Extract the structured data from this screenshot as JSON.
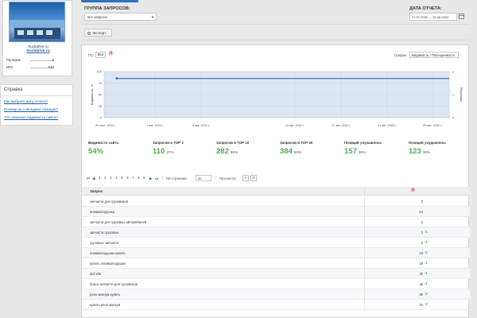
{
  "sidebar": {
    "site_domain": "truckdrive.ru",
    "site_link": "truckdrive.ru",
    "metrics": [
      {
        "label": "РејтБанк",
        "value": "0"
      },
      {
        "label": "ИКС",
        "value": "540"
      }
    ],
    "help": {
      "title": "Справка",
      "links": [
        "Как выбрать дату отчета?",
        "Почему не совпадают позиции?",
        "Что означает видимость сайта?"
      ]
    }
  },
  "filters": {
    "group_label": "ГРУППА ЗАПРОСОВ:",
    "group_value": "все запросы",
    "date_label": "ДАТА ОТЧЕТА:",
    "date_value": "27.07.2022 — 26.08.2022",
    "export_label": "Экспорт"
  },
  "chart_controls": {
    "ps_label": "ПС:",
    "ps_all": "Все",
    "ya_logo": "Я",
    "graph_label": "График:",
    "graph_value": "Видимость / Посещаемость"
  },
  "chart_data": {
    "type": "line",
    "xlabel": "",
    "ylabel": "Видимость, %",
    "y2label": "Переходы",
    "x_ticks": [
      "26 июл. 2022 г.",
      "1 авг. 2022 г.",
      "5 авг. 2022 г.",
      "13 авг. 2022 г.",
      "17 авг. 2022 г.",
      "21 авг. 2022 г.",
      "25 авг. 2022 г."
    ],
    "y_ticks": [
      0,
      25,
      50,
      75,
      100
    ],
    "y2_ticks": [
      0,
      1,
      2
    ],
    "ylim": [
      0,
      100
    ],
    "y2lim": [
      0,
      2
    ],
    "series": [
      {
        "values": [
          85,
          85,
          85,
          85,
          85,
          85,
          85,
          85,
          85,
          85,
          85,
          85,
          85,
          85,
          85,
          85,
          85,
          85,
          85,
          85,
          85,
          85,
          85,
          85,
          85,
          85,
          85,
          85,
          85,
          85,
          85
        ]
      }
    ],
    "grid": true,
    "colors": {
      "line": "#4a7fb5",
      "area": "#dce6f0"
    }
  },
  "stats": [
    {
      "label": "Видимость сайта",
      "value": "54%",
      "pct": ""
    },
    {
      "label": "Запросов в ТОР 3",
      "value": "110",
      "pct": "27%"
    },
    {
      "label": "Запросов в ТОР 10",
      "value": "282",
      "pct": "69%"
    },
    {
      "label": "Запросов в ТОР 30",
      "value": "384",
      "pct": "93%"
    },
    {
      "label": "Позиций улучшилось",
      "value": "157",
      "pct": "38%"
    },
    {
      "label": "Позиций ухудшилось",
      "value": "123",
      "pct": "30%"
    }
  ],
  "pager": {
    "pages": [
      "1",
      "2",
      "3",
      "4",
      "5",
      "6",
      "7",
      "8",
      "9"
    ],
    "per_page_label": "На странице:",
    "per_page_value": "50",
    "view_label": "Просмотр:"
  },
  "table": {
    "header_query": "Запрос",
    "header_ya": "Я",
    "rows": [
      {
        "query": "запчасти для грузовиков",
        "value": "2",
        "change": ""
      },
      {
        "query": "пневмоподушка",
        "value": "13",
        "change": ""
      },
      {
        "query": "запчасти для грузовых автомобилей",
        "value": "2",
        "change": ""
      },
      {
        "query": "запчасти грузовые",
        "value": "2",
        "change": "↑1"
      },
      {
        "query": "грузовые запчасти",
        "value": "2",
        "change": "↑1"
      },
      {
        "query": "пневмоподушки купить",
        "value": "16",
        "change": "↑2"
      },
      {
        "query": "купить пневмоподушки",
        "value": "19",
        "change": "↑1"
      },
      {
        "query": "daf 105",
        "value": "25",
        "change": "↑1"
      },
      {
        "query": "бокса запчасти для грузовиков",
        "value": "46",
        "change": "↑1"
      },
      {
        "query": "рено магнум купить",
        "value": "30",
        "change": "↑2"
      },
      {
        "query": "купить рено магнум",
        "value": "34",
        "change": "↑2"
      }
    ]
  }
}
